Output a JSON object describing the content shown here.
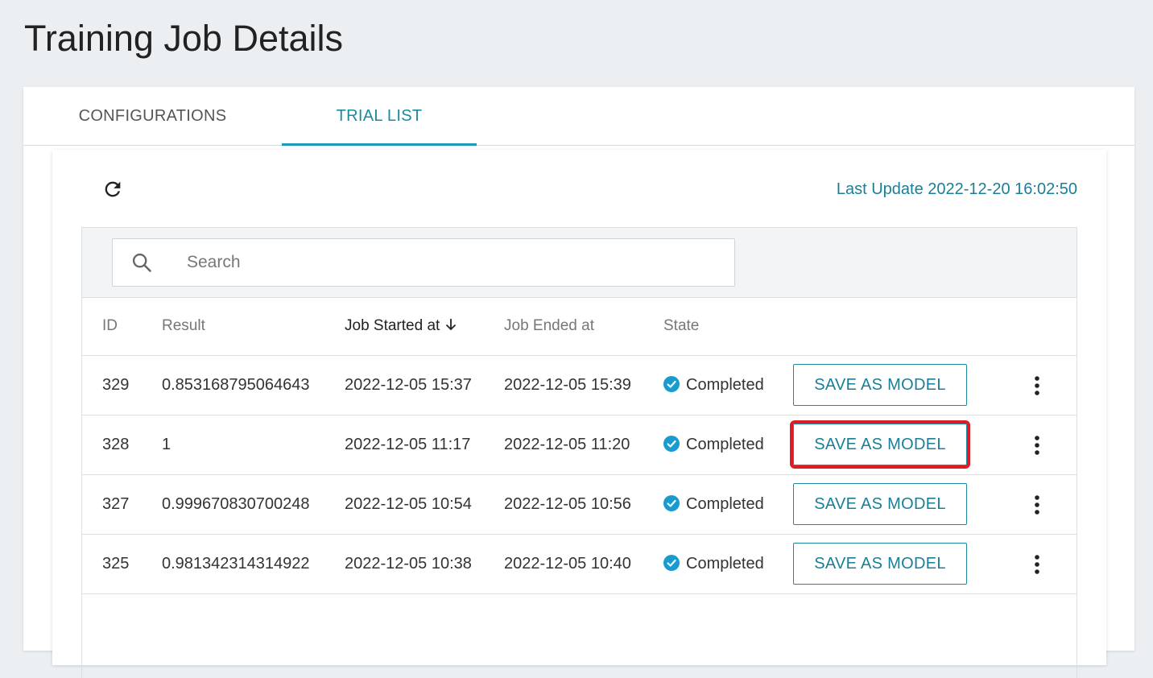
{
  "page": {
    "title": "Training Job Details"
  },
  "tabs": [
    {
      "label": "CONFIGURATIONS",
      "active": false
    },
    {
      "label": "TRIAL LIST",
      "active": true
    }
  ],
  "toolbar": {
    "refresh_icon": "refresh-icon",
    "last_update": "Last Update 2022-12-20 16:02:50"
  },
  "search": {
    "icon": "search-icon",
    "placeholder": "Search",
    "value": ""
  },
  "table": {
    "columns": {
      "id": "ID",
      "result": "Result",
      "started": "Job Started at",
      "ended": "Job Ended at",
      "state": "State"
    },
    "sorted_column": "started",
    "sort_direction": "descending",
    "rows": [
      {
        "id": "329",
        "result": "0.853168795064643",
        "started": "2022-12-05 15:37",
        "ended": "2022-12-05 15:39",
        "state": "Completed",
        "action": "SAVE AS MODEL"
      },
      {
        "id": "328",
        "result": "1",
        "started": "2022-12-05 11:17",
        "ended": "2022-12-05 11:20",
        "state": "Completed",
        "action": "SAVE AS MODEL"
      },
      {
        "id": "327",
        "result": "0.999670830700248",
        "started": "2022-12-05 10:54",
        "ended": "2022-12-05 10:56",
        "state": "Completed",
        "action": "SAVE AS MODEL"
      },
      {
        "id": "325",
        "result": "0.981342314314922",
        "started": "2022-12-05 10:38",
        "ended": "2022-12-05 10:40",
        "state": "Completed",
        "action": "SAVE AS MODEL"
      }
    ]
  },
  "colors": {
    "accent": "#1a8aa0",
    "status_completed": "#1a9bd0",
    "highlight": "#e01b24"
  }
}
